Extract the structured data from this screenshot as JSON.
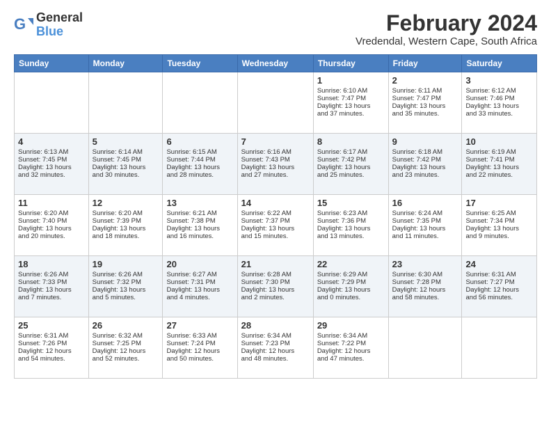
{
  "logo": {
    "general": "General",
    "blue": "Blue"
  },
  "title": {
    "month_year": "February 2024",
    "location": "Vredendal, Western Cape, South Africa"
  },
  "headers": [
    "Sunday",
    "Monday",
    "Tuesday",
    "Wednesday",
    "Thursday",
    "Friday",
    "Saturday"
  ],
  "weeks": [
    {
      "days": [
        {
          "num": "",
          "info": "",
          "empty": true
        },
        {
          "num": "",
          "info": "",
          "empty": true
        },
        {
          "num": "",
          "info": "",
          "empty": true
        },
        {
          "num": "",
          "info": "",
          "empty": true
        },
        {
          "num": "1",
          "info": "Sunrise: 6:10 AM\nSunset: 7:47 PM\nDaylight: 13 hours\nand 37 minutes.",
          "empty": false
        },
        {
          "num": "2",
          "info": "Sunrise: 6:11 AM\nSunset: 7:47 PM\nDaylight: 13 hours\nand 35 minutes.",
          "empty": false
        },
        {
          "num": "3",
          "info": "Sunrise: 6:12 AM\nSunset: 7:46 PM\nDaylight: 13 hours\nand 33 minutes.",
          "empty": false
        }
      ]
    },
    {
      "days": [
        {
          "num": "4",
          "info": "Sunrise: 6:13 AM\nSunset: 7:45 PM\nDaylight: 13 hours\nand 32 minutes.",
          "empty": false
        },
        {
          "num": "5",
          "info": "Sunrise: 6:14 AM\nSunset: 7:45 PM\nDaylight: 13 hours\nand 30 minutes.",
          "empty": false
        },
        {
          "num": "6",
          "info": "Sunrise: 6:15 AM\nSunset: 7:44 PM\nDaylight: 13 hours\nand 28 minutes.",
          "empty": false
        },
        {
          "num": "7",
          "info": "Sunrise: 6:16 AM\nSunset: 7:43 PM\nDaylight: 13 hours\nand 27 minutes.",
          "empty": false
        },
        {
          "num": "8",
          "info": "Sunrise: 6:17 AM\nSunset: 7:42 PM\nDaylight: 13 hours\nand 25 minutes.",
          "empty": false
        },
        {
          "num": "9",
          "info": "Sunrise: 6:18 AM\nSunset: 7:42 PM\nDaylight: 13 hours\nand 23 minutes.",
          "empty": false
        },
        {
          "num": "10",
          "info": "Sunrise: 6:19 AM\nSunset: 7:41 PM\nDaylight: 13 hours\nand 22 minutes.",
          "empty": false
        }
      ]
    },
    {
      "days": [
        {
          "num": "11",
          "info": "Sunrise: 6:20 AM\nSunset: 7:40 PM\nDaylight: 13 hours\nand 20 minutes.",
          "empty": false
        },
        {
          "num": "12",
          "info": "Sunrise: 6:20 AM\nSunset: 7:39 PM\nDaylight: 13 hours\nand 18 minutes.",
          "empty": false
        },
        {
          "num": "13",
          "info": "Sunrise: 6:21 AM\nSunset: 7:38 PM\nDaylight: 13 hours\nand 16 minutes.",
          "empty": false
        },
        {
          "num": "14",
          "info": "Sunrise: 6:22 AM\nSunset: 7:37 PM\nDaylight: 13 hours\nand 15 minutes.",
          "empty": false
        },
        {
          "num": "15",
          "info": "Sunrise: 6:23 AM\nSunset: 7:36 PM\nDaylight: 13 hours\nand 13 minutes.",
          "empty": false
        },
        {
          "num": "16",
          "info": "Sunrise: 6:24 AM\nSunset: 7:35 PM\nDaylight: 13 hours\nand 11 minutes.",
          "empty": false
        },
        {
          "num": "17",
          "info": "Sunrise: 6:25 AM\nSunset: 7:34 PM\nDaylight: 13 hours\nand 9 minutes.",
          "empty": false
        }
      ]
    },
    {
      "days": [
        {
          "num": "18",
          "info": "Sunrise: 6:26 AM\nSunset: 7:33 PM\nDaylight: 13 hours\nand 7 minutes.",
          "empty": false
        },
        {
          "num": "19",
          "info": "Sunrise: 6:26 AM\nSunset: 7:32 PM\nDaylight: 13 hours\nand 5 minutes.",
          "empty": false
        },
        {
          "num": "20",
          "info": "Sunrise: 6:27 AM\nSunset: 7:31 PM\nDaylight: 13 hours\nand 4 minutes.",
          "empty": false
        },
        {
          "num": "21",
          "info": "Sunrise: 6:28 AM\nSunset: 7:30 PM\nDaylight: 13 hours\nand 2 minutes.",
          "empty": false
        },
        {
          "num": "22",
          "info": "Sunrise: 6:29 AM\nSunset: 7:29 PM\nDaylight: 13 hours\nand 0 minutes.",
          "empty": false
        },
        {
          "num": "23",
          "info": "Sunrise: 6:30 AM\nSunset: 7:28 PM\nDaylight: 12 hours\nand 58 minutes.",
          "empty": false
        },
        {
          "num": "24",
          "info": "Sunrise: 6:31 AM\nSunset: 7:27 PM\nDaylight: 12 hours\nand 56 minutes.",
          "empty": false
        }
      ]
    },
    {
      "days": [
        {
          "num": "25",
          "info": "Sunrise: 6:31 AM\nSunset: 7:26 PM\nDaylight: 12 hours\nand 54 minutes.",
          "empty": false
        },
        {
          "num": "26",
          "info": "Sunrise: 6:32 AM\nSunset: 7:25 PM\nDaylight: 12 hours\nand 52 minutes.",
          "empty": false
        },
        {
          "num": "27",
          "info": "Sunrise: 6:33 AM\nSunset: 7:24 PM\nDaylight: 12 hours\nand 50 minutes.",
          "empty": false
        },
        {
          "num": "28",
          "info": "Sunrise: 6:34 AM\nSunset: 7:23 PM\nDaylight: 12 hours\nand 48 minutes.",
          "empty": false
        },
        {
          "num": "29",
          "info": "Sunrise: 6:34 AM\nSunset: 7:22 PM\nDaylight: 12 hours\nand 47 minutes.",
          "empty": false
        },
        {
          "num": "",
          "info": "",
          "empty": true
        },
        {
          "num": "",
          "info": "",
          "empty": true
        }
      ]
    }
  ]
}
